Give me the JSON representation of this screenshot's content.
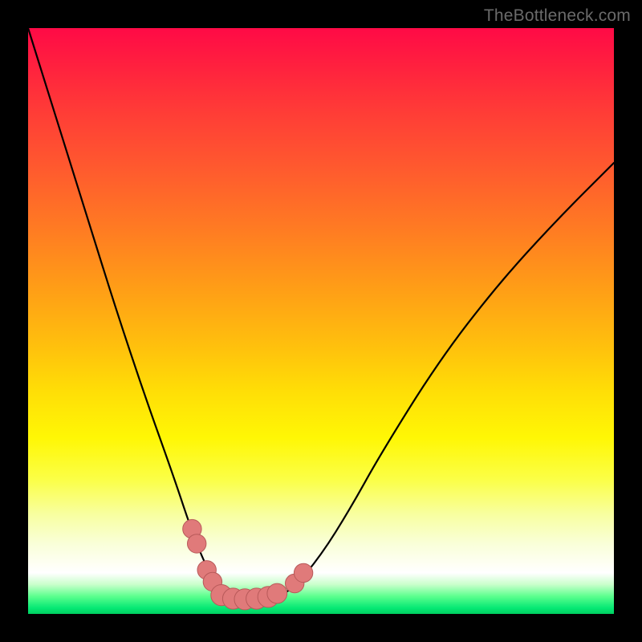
{
  "watermark": "TheBottleneck.com",
  "colors": {
    "bead_fill": "#e07a7a",
    "bead_stroke": "#b85a5a",
    "curve_stroke": "#000000"
  },
  "chart_data": {
    "type": "line",
    "title": "",
    "xlabel": "",
    "ylabel": "",
    "xlim": [
      0,
      100
    ],
    "ylim": [
      0,
      100
    ],
    "grid": false,
    "legend": false,
    "series": [
      {
        "name": "curve",
        "x": [
          0,
          5,
          10,
          15,
          20,
          25,
          28,
          30,
          32,
          34,
          36,
          38,
          42,
          45,
          50,
          55,
          60,
          70,
          80,
          90,
          100
        ],
        "y": [
          100,
          84,
          68,
          52,
          37,
          23,
          14,
          9,
          5,
          3,
          2.5,
          2.5,
          3,
          4,
          10,
          18,
          27,
          43,
          56,
          67,
          77
        ],
        "note": "y is percentage of vertical height from bottom (0=bottom, 100=top); visually matches the V-shaped black curve"
      }
    ],
    "markers": [
      {
        "name": "bead-left-upper",
        "x": 28.0,
        "y": 14.5,
        "r": 1.6
      },
      {
        "name": "bead-left-upper2",
        "x": 28.8,
        "y": 12.0,
        "r": 1.6
      },
      {
        "name": "bead-left-mid",
        "x": 30.5,
        "y": 7.5,
        "r": 1.6
      },
      {
        "name": "bead-left-low",
        "x": 31.5,
        "y": 5.5,
        "r": 1.6
      },
      {
        "name": "bead-bottom-1",
        "x": 33.0,
        "y": 3.2,
        "r": 1.8
      },
      {
        "name": "bead-bottom-2",
        "x": 35.0,
        "y": 2.6,
        "r": 1.8
      },
      {
        "name": "bead-bottom-3",
        "x": 37.0,
        "y": 2.5,
        "r": 1.8
      },
      {
        "name": "bead-bottom-4",
        "x": 39.0,
        "y": 2.6,
        "r": 1.8
      },
      {
        "name": "bead-bottom-5",
        "x": 41.0,
        "y": 2.9,
        "r": 1.8
      },
      {
        "name": "bead-right-low",
        "x": 42.5,
        "y": 3.5,
        "r": 1.7
      },
      {
        "name": "bead-right-up1",
        "x": 45.5,
        "y": 5.2,
        "r": 1.6
      },
      {
        "name": "bead-right-up2",
        "x": 47.0,
        "y": 7.0,
        "r": 1.6
      }
    ]
  }
}
